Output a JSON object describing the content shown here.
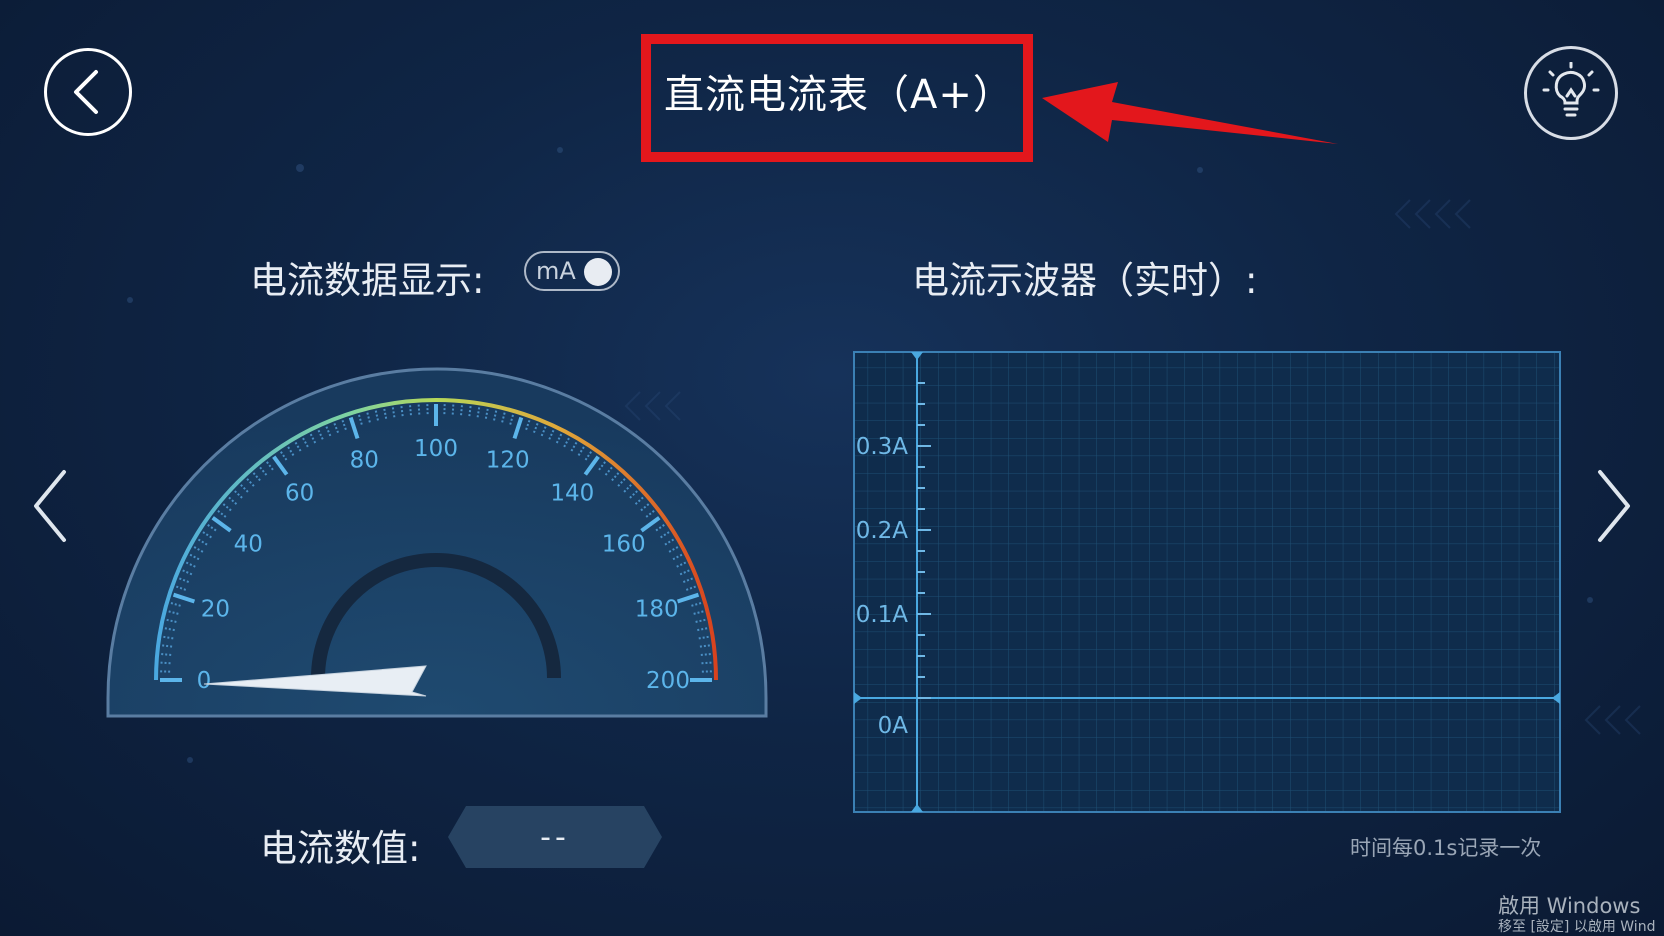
{
  "header": {
    "title": "直流电流表（A+）"
  },
  "left_panel": {
    "label": "电流数据显示:",
    "unit_toggle": "mA",
    "gauge": {
      "min": 0,
      "max": 200,
      "ticks": [
        "0",
        "20",
        "40",
        "60",
        "80",
        "100",
        "120",
        "140",
        "160",
        "180",
        "200"
      ],
      "needle_value": 0
    },
    "value_label": "电流数值:",
    "value": "--"
  },
  "right_panel": {
    "label": "电流示波器（实时）:",
    "y_ticks": [
      "0.3A",
      "0.2A",
      "0.1A",
      "0A"
    ],
    "note": "时间每0.1s记录一次"
  },
  "watermark": {
    "line1": "啟用 Windows",
    "line2": "移至 [設定] 以啟用 Wind"
  },
  "colors": {
    "accent": "#5cb5ea",
    "highlight_box": "#e3171c",
    "gauge_start": "#4aa8e0",
    "gauge_mid": "#9ad860",
    "gauge_end": "#d8421e"
  }
}
